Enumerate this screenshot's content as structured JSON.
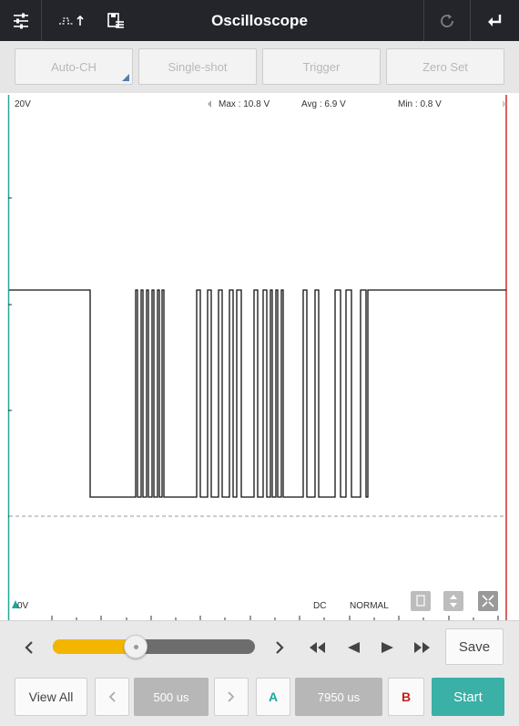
{
  "app": {
    "title": "Oscilloscope"
  },
  "toolbar": {
    "buttons": [
      {
        "label": "Auto-CH"
      },
      {
        "label": "Single-shot"
      },
      {
        "label": "Trigger"
      },
      {
        "label": "Zero Set"
      }
    ]
  },
  "scope": {
    "scale_label": "20V",
    "max_label": "Max : 10.8 V",
    "avg_label": "Avg : 6.9 V",
    "min_label": "Min : 0.8 V",
    "zero_label": "0V",
    "coupling": "DC",
    "mode": "NORMAL"
  },
  "controls": {
    "save_label": "Save",
    "slider_level": 0.4
  },
  "bottom": {
    "view_all": "View All",
    "time_div": "500 us",
    "cursor_a": "A",
    "cursor_time": "7950 us",
    "cursor_b": "B",
    "start": "Start"
  },
  "colors": {
    "title_bar": "#23252b",
    "accent_teal": "#3fbfb0",
    "cursor_a": "#19a99b",
    "cursor_b": "#d22b2b",
    "slider_fill": "#f2b600",
    "start_button": "#3ab0a7"
  }
}
